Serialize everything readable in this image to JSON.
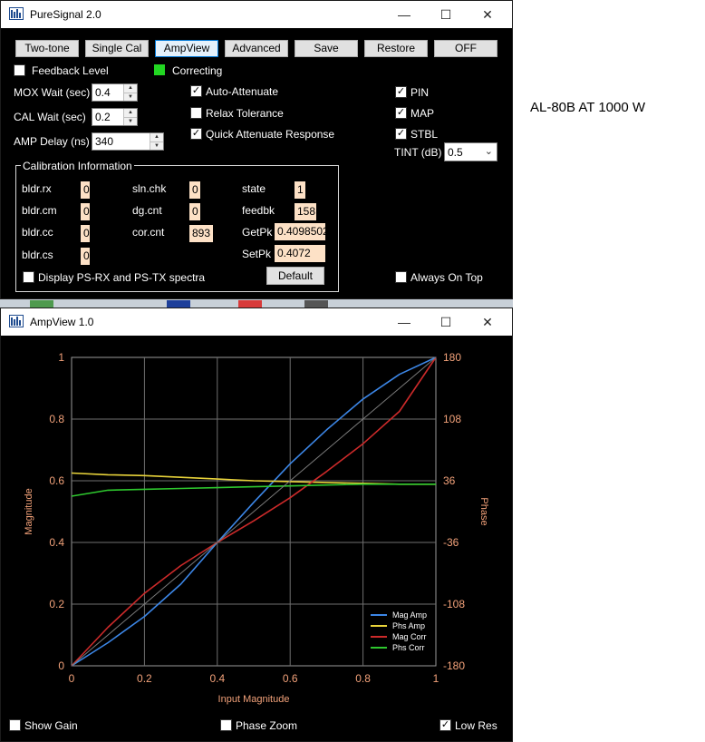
{
  "puresignal": {
    "title": "PureSignal 2.0",
    "buttons": [
      "Two-tone",
      "Single Cal",
      "AmpView",
      "Advanced",
      "Save",
      "Restore",
      "OFF"
    ],
    "feedback_level": "Feedback Level",
    "correcting": "Correcting",
    "mox_wait_label": "MOX Wait (sec)",
    "mox_wait": "0.4",
    "cal_wait_label": "CAL Wait (sec)",
    "cal_wait": "0.2",
    "amp_delay_label": "AMP Delay (ns)",
    "amp_delay": "340",
    "auto_attenuate": "Auto-Attenuate",
    "relax_tolerance": "Relax Tolerance",
    "quick_attenuate": "Quick Attenuate Response",
    "pin": "PIN",
    "map": "MAP",
    "stbl": "STBL",
    "tint_label": "TINT (dB)",
    "tint": "0.5",
    "calibration": {
      "title": "Calibration Information",
      "bldr_rx_label": "bldr.rx",
      "bldr_rx": "0",
      "bldr_cm_label": "bldr.cm",
      "bldr_cm": "0",
      "bldr_cc_label": "bldr.cc",
      "bldr_cc": "0",
      "bldr_cs_label": "bldr.cs",
      "bldr_cs": "0",
      "sln_chk_label": "sln.chk",
      "sln_chk": "0",
      "dg_cnt_label": "dg.cnt",
      "dg_cnt": "0",
      "cor_cnt_label": "cor.cnt",
      "cor_cnt": "893",
      "state_label": "state",
      "state": "1",
      "feedbk_label": "feedbk",
      "feedbk": "158",
      "getpk_label": "GetPk",
      "getpk": "0.4098502",
      "setpk_label": "SetPk",
      "setpk": "0.4072"
    },
    "display_spectra": "Display PS-RX and PS-TX spectra",
    "default_button": "Default",
    "always_on_top": "Always On Top"
  },
  "external_label": "AL-80B AT 1000 W",
  "ampview": {
    "title": "AmpView 1.0",
    "show_gain": "Show Gain",
    "phase_zoom": "Phase Zoom",
    "low_res": "Low Res"
  },
  "colors": {
    "mag_amp": "#3c86e6",
    "phs_amp": "#e8d33a",
    "mag_corr": "#cc2a2a",
    "phs_corr": "#2ec82e",
    "axis_text": "#f3a27a",
    "correcting_led": "#22d622"
  },
  "chart_data": {
    "type": "line",
    "xlabel": "Input Magnitude",
    "ylabel": "Magnitude",
    "y2label": "Phase",
    "xlim": [
      0,
      1
    ],
    "ylim": [
      0,
      1
    ],
    "y2lim": [
      -180,
      180
    ],
    "x_ticks": [
      "0",
      "0.2",
      "0.4",
      "0.6",
      "0.8",
      "1"
    ],
    "y_ticks": [
      "0",
      "0.2",
      "0.4",
      "0.6",
      "0.8",
      "1"
    ],
    "y2_ticks": [
      "-180",
      "-108",
      "-36",
      "36",
      "108",
      "180"
    ],
    "grid": true,
    "legend_position": "bottom-right",
    "x": [
      0,
      0.1,
      0.2,
      0.3,
      0.4,
      0.5,
      0.6,
      0.7,
      0.8,
      0.9,
      1.0
    ],
    "series": [
      {
        "name": "Mag Amp",
        "axis": "left",
        "values": [
          0,
          0.075,
          0.16,
          0.265,
          0.4,
          0.53,
          0.655,
          0.765,
          0.865,
          0.945,
          1.0
        ]
      },
      {
        "name": "Phs Amp",
        "axis": "right",
        "values": [
          45,
          43,
          42,
          40,
          38,
          36,
          35,
          34,
          33,
          32,
          32
        ]
      },
      {
        "name": "Mag Corr",
        "axis": "left",
        "values": [
          0,
          0.125,
          0.235,
          0.325,
          0.4,
          0.47,
          0.545,
          0.63,
          0.72,
          0.825,
          1.0
        ]
      },
      {
        "name": "Phs Corr",
        "axis": "right",
        "values": [
          18,
          25,
          26,
          27,
          28,
          29,
          30,
          31,
          32,
          32,
          32
        ]
      },
      {
        "name": "",
        "axis": "left",
        "values": [
          0,
          0.1,
          0.2,
          0.3,
          0.4,
          0.5,
          0.6,
          0.7,
          0.8,
          0.9,
          1.0
        ]
      }
    ]
  }
}
